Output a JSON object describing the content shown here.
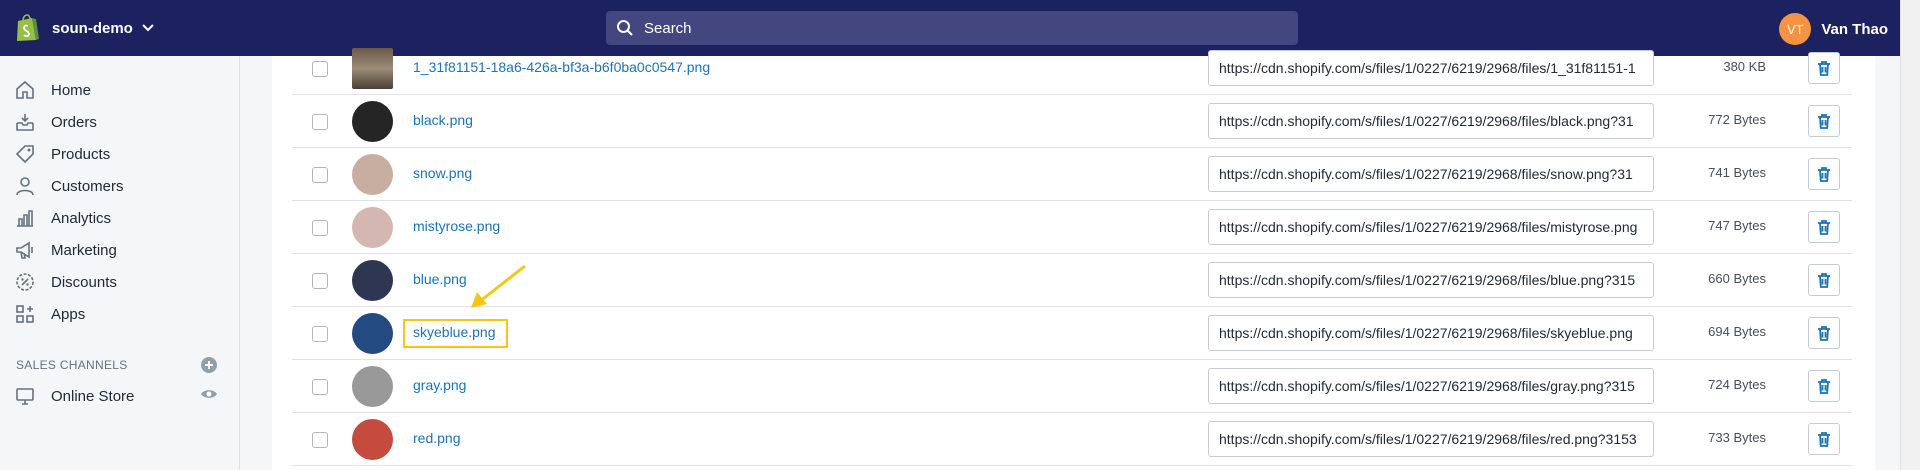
{
  "topbar": {
    "store_name": "soun-demo",
    "search_placeholder": "Search",
    "user_initials": "VT",
    "user_name": "Van Thao"
  },
  "sidebar": {
    "items": [
      {
        "label": "Home",
        "icon": "home-icon"
      },
      {
        "label": "Orders",
        "icon": "orders-icon"
      },
      {
        "label": "Products",
        "icon": "tag-icon"
      },
      {
        "label": "Customers",
        "icon": "person-icon"
      },
      {
        "label": "Analytics",
        "icon": "bar-chart-icon"
      },
      {
        "label": "Marketing",
        "icon": "megaphone-icon"
      },
      {
        "label": "Discounts",
        "icon": "discount-icon"
      },
      {
        "label": "Apps",
        "icon": "apps-icon"
      }
    ],
    "sales_channels_title": "SALES CHANNELS",
    "channels": [
      {
        "label": "Online Store",
        "icon": "store-icon"
      }
    ]
  },
  "files": [
    {
      "name": "1_31f81151-18a6-426a-bf3a-b6f0ba0c0547.png",
      "url": "https://cdn.shopify.com/s/files/1/0227/6219/2968/files/1_31f81151-1",
      "size": "380 KB",
      "thumb": "photo"
    },
    {
      "name": "black.png",
      "url": "https://cdn.shopify.com/s/files/1/0227/6219/2968/files/black.png?31",
      "size": "772 Bytes",
      "color": "#252525"
    },
    {
      "name": "snow.png",
      "url": "https://cdn.shopify.com/s/files/1/0227/6219/2968/files/snow.png?31",
      "size": "741 Bytes",
      "color": "#c8aea0"
    },
    {
      "name": "mistyrose.png",
      "url": "https://cdn.shopify.com/s/files/1/0227/6219/2968/files/mistyrose.png",
      "size": "747 Bytes",
      "color": "#d5b7b1"
    },
    {
      "name": "blue.png",
      "url": "https://cdn.shopify.com/s/files/1/0227/6219/2968/files/blue.png?315",
      "size": "660 Bytes",
      "color": "#2f3654"
    },
    {
      "name": "skyeblue.png",
      "url": "https://cdn.shopify.com/s/files/1/0227/6219/2968/files/skyeblue.png",
      "size": "694 Bytes",
      "color": "#244a82"
    },
    {
      "name": "gray.png",
      "url": "https://cdn.shopify.com/s/files/1/0227/6219/2968/files/gray.png?315",
      "size": "724 Bytes",
      "color": "#999999"
    },
    {
      "name": "red.png",
      "url": "https://cdn.shopify.com/s/files/1/0227/6219/2968/files/red.png?3153",
      "size": "733 Bytes",
      "color": "#c64b3f"
    }
  ],
  "colors": {
    "topbar": "#1c2260",
    "link": "#1e73b4",
    "highlight": "#f5c518",
    "delete_icon": "#1e73b4"
  }
}
